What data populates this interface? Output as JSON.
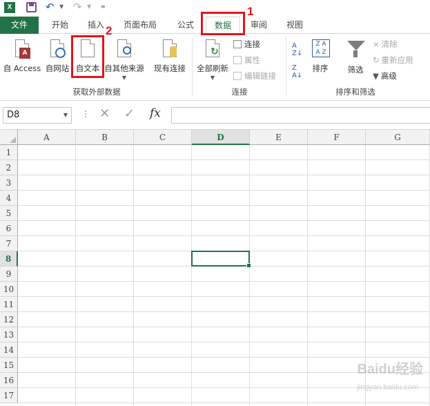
{
  "qat": {
    "app_icon": "X",
    "undo_icon": "undo-icon",
    "redo_icon": "redo-icon"
  },
  "tabs": [
    {
      "label": "文件"
    },
    {
      "label": "开始"
    },
    {
      "label": "插入"
    },
    {
      "label": "页面布局"
    },
    {
      "label": "公式"
    },
    {
      "label": "数据"
    },
    {
      "label": "审阅"
    },
    {
      "label": "视图"
    }
  ],
  "ribbon": {
    "get_external": {
      "from_access": "自 Access",
      "from_web": "自网站",
      "from_text": "自文本",
      "from_other": "自其他来源",
      "existing": "现有连接",
      "group_label": "获取外部数据"
    },
    "connections": {
      "refresh_all": "全部刷新",
      "connections": "连接",
      "properties": "属性",
      "edit_links": "编辑链接",
      "group_label": "连接"
    },
    "sort_filter": {
      "sort": "排序",
      "filter": "筛选",
      "clear": "清除",
      "reapply": "重新应用",
      "advanced": "高级",
      "group_label": "排序和筛选"
    }
  },
  "annotations": {
    "step1": "1",
    "step2": "2"
  },
  "formula_bar": {
    "name_box": "D8",
    "fx": "fx",
    "formula": ""
  },
  "grid": {
    "columns": [
      "A",
      "B",
      "C",
      "D",
      "E",
      "F",
      "G"
    ],
    "rows": [
      "1",
      "2",
      "3",
      "4",
      "5",
      "6",
      "7",
      "8",
      "9",
      "10",
      "11",
      "12",
      "13",
      "14",
      "15",
      "16",
      "17"
    ],
    "selected_cell": "D8"
  },
  "watermark": {
    "text": "Baidu经验",
    "sub": "jingyan.baidu.com"
  },
  "colors": {
    "excel_green": "#217346",
    "annotation_red": "#e0151b"
  }
}
